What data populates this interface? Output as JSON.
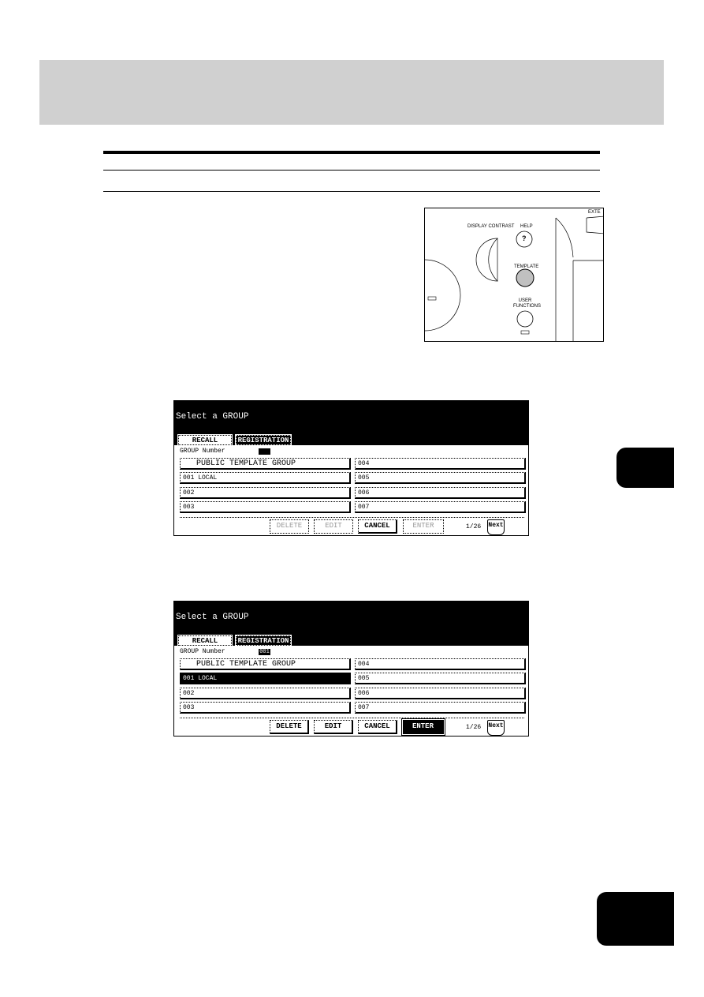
{
  "illustration": {
    "display_contrast": "DISPLAY CONTRAST",
    "help": "HELP",
    "help_symbol": "?",
    "template": "TEMPLATE",
    "user_functions": "USER FUNCTIONS",
    "ext": "EXTE",
    "template_button_color": "#c0c0c0"
  },
  "panels": [
    {
      "title": "Select a GROUP",
      "tabs": {
        "recall": "RECALL",
        "registration": "REGISTRATION"
      },
      "group_number_label": "GROUP Number",
      "group_number_value": "",
      "items": [
        "PUBLIC TEMPLATE GROUP",
        "001 LOCAL",
        "002",
        "003",
        "004",
        "005",
        "006",
        "007"
      ],
      "selected_index": -1,
      "buttons": {
        "delete": "DELETE",
        "edit": "EDIT",
        "cancel": "CANCEL",
        "enter": "ENTER"
      },
      "disabled": [
        "delete",
        "edit",
        "enter"
      ],
      "active": [],
      "page": "1/26",
      "next": "Next"
    },
    {
      "title": "Select a GROUP",
      "tabs": {
        "recall": "RECALL",
        "registration": "REGISTRATION"
      },
      "group_number_label": "GROUP Number",
      "group_number_value": "001",
      "items": [
        "PUBLIC TEMPLATE GROUP",
        "001 LOCAL",
        "002",
        "003",
        "004",
        "005",
        "006",
        "007"
      ],
      "selected_index": 1,
      "buttons": {
        "delete": "DELETE",
        "edit": "EDIT",
        "cancel": "CANCEL",
        "enter": "ENTER"
      },
      "disabled": [],
      "active": [
        "enter"
      ],
      "page": "1/26",
      "next": "Next"
    }
  ]
}
